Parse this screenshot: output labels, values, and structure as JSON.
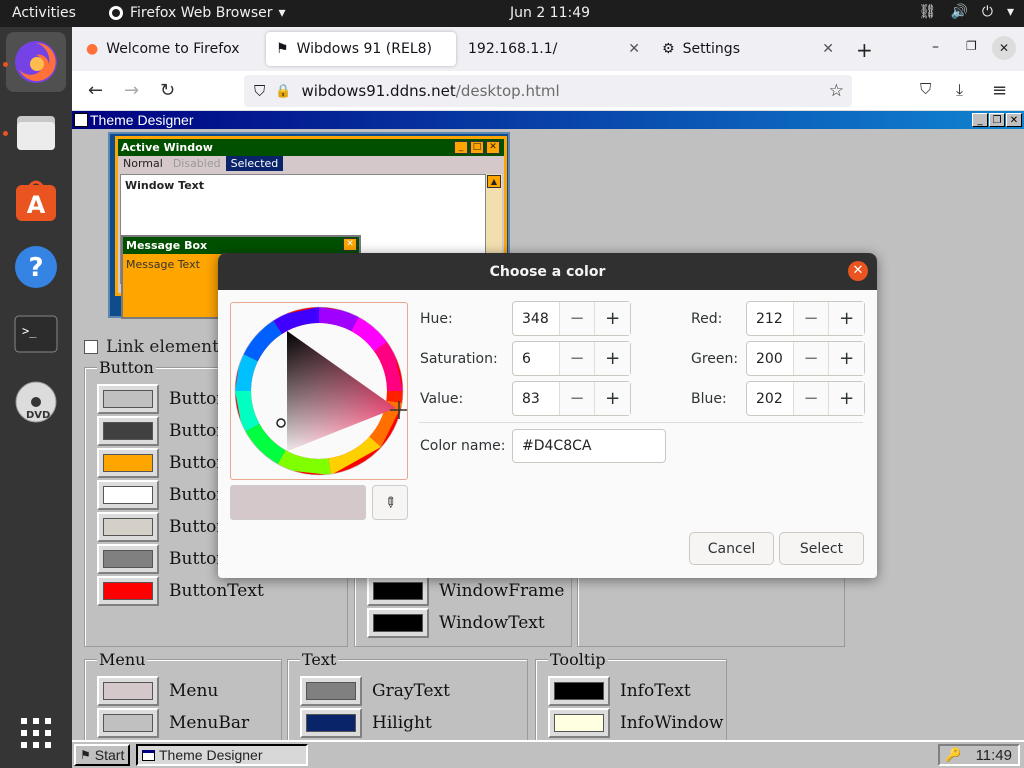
{
  "topbar": {
    "activities": "Activities",
    "app_name": "Firefox Web Browser",
    "clock": "Jun 2  11:49"
  },
  "browser": {
    "tabs": [
      {
        "label": "Welcome to Firefox"
      },
      {
        "label": "Wibdows 91 (REL8)"
      },
      {
        "label": "192.168.1.1/"
      },
      {
        "label": "Settings"
      }
    ],
    "url_host": "wibdows91.ddns.net",
    "url_path": "/desktop.html"
  },
  "wibdows": {
    "window_title": "Theme Designer",
    "preview": {
      "active_window": "Active Window",
      "menu_normal": "Normal",
      "menu_disabled": "Disabled",
      "menu_selected": "Selected",
      "window_text": "Window Text",
      "message_box": "Message Box",
      "message_text": "Message Text"
    },
    "link_elements": "Link elements",
    "groups": {
      "button": {
        "legend": "Button",
        "items": [
          {
            "label": "Button",
            "color": "#c0c0c0"
          },
          {
            "label": "Button",
            "color": "#404040"
          },
          {
            "label": "Button",
            "color": "#ffa500"
          },
          {
            "label": "Button",
            "color": "#ffffff"
          },
          {
            "label": "Button",
            "color": "#d4d0c8"
          },
          {
            "label": "Button",
            "color": "#808080"
          },
          {
            "label": "ButtonText",
            "color": "#ff0000"
          }
        ]
      },
      "window": {
        "items": [
          {
            "label": "WindowFrame",
            "color": "#000000"
          },
          {
            "label": "WindowText",
            "color": "#000000"
          }
        ]
      },
      "menu": {
        "legend": "Menu",
        "items": [
          {
            "label": "Menu",
            "color": "#d4c8ca"
          },
          {
            "label": "MenuBar",
            "color": "#c0c0c0"
          }
        ]
      },
      "text": {
        "legend": "Text",
        "items": [
          {
            "label": "GrayText",
            "color": "#808080"
          },
          {
            "label": "Hilight",
            "color": "#0a246a"
          }
        ]
      },
      "tooltip": {
        "legend": "Tooltip",
        "items": [
          {
            "label": "InfoText",
            "color": "#000000"
          },
          {
            "label": "InfoWindow",
            "color": "#ffffe1"
          }
        ]
      }
    },
    "taskbar": {
      "start": "Start",
      "task": "Theme Designer",
      "clock": "11:49"
    }
  },
  "color_dialog": {
    "title": "Choose a color",
    "hue_label": "Hue:",
    "hue": "348",
    "saturation_label": "Saturation:",
    "saturation": "6",
    "value_label": "Value:",
    "value": "83",
    "red_label": "Red:",
    "red": "212",
    "green_label": "Green:",
    "green": "200",
    "blue_label": "Blue:",
    "blue": "202",
    "color_name_label": "Color name:",
    "color_name": "#D4C8CA",
    "cancel": "Cancel",
    "select": "Select",
    "current_color": "#d4c8ca"
  }
}
